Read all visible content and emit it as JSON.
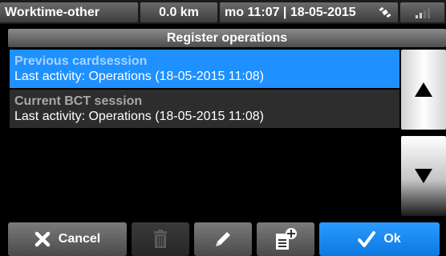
{
  "status_bar": {
    "activity": "Worktime-other",
    "distance": "0.0 km",
    "datetime": "mo 11:07 | 18-05-2015"
  },
  "title": "Register operations",
  "list": {
    "items": [
      {
        "title": "Previous cardsession",
        "subtitle": "Last activity: Operations (18-05-2015 11:08)",
        "selected": true
      },
      {
        "title": "Current BCT session",
        "subtitle": "Last activity: Operations (18-05-2015 11:08)",
        "selected": false
      }
    ]
  },
  "toolbar": {
    "cancel_label": "Cancel",
    "ok_label": "Ok"
  },
  "colors": {
    "selected": "#1e90ff",
    "ok_button": "#0b78e0"
  },
  "icons": [
    "satellite-icon",
    "signal-icon",
    "scroll-up-icon",
    "scroll-down-icon",
    "close-icon",
    "trash-icon",
    "pencil-icon",
    "add-document-icon",
    "check-icon"
  ]
}
